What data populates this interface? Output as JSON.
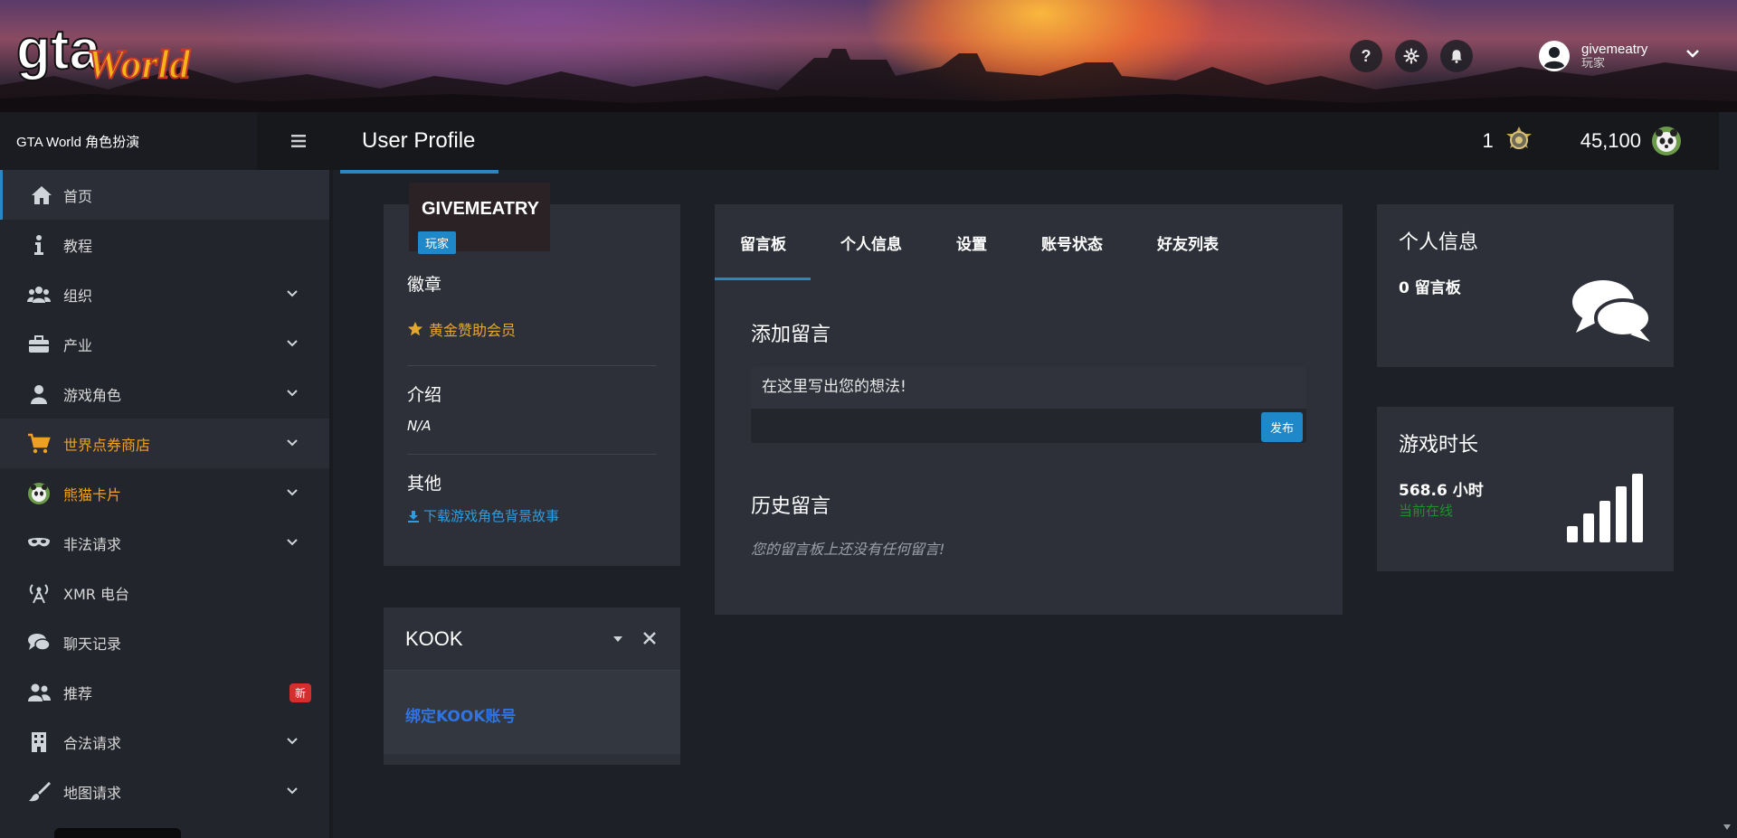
{
  "banner": {
    "logo_text_gta": "gta",
    "logo_text_world": "World",
    "icons": [
      "question-icon",
      "gear-icon",
      "bell-icon"
    ],
    "help_glyph": "?",
    "user": {
      "name": "givemeatry",
      "role": "玩家"
    }
  },
  "sidebar_head": {
    "title": "GTA World 角色扮演"
  },
  "topbar": {
    "page_title": "User Profile",
    "stats": [
      {
        "value": "1",
        "icon": "medal-icon"
      },
      {
        "value": "45,100",
        "icon": "panda-coin-icon"
      }
    ]
  },
  "sidebar": {
    "items": [
      {
        "label": "首页",
        "icon": "home-icon",
        "active": true
      },
      {
        "label": "教程",
        "icon": "info-icon"
      },
      {
        "label": "组织",
        "icon": "users-icon",
        "expand": true
      },
      {
        "label": "产业",
        "icon": "briefcase-icon",
        "expand": true
      },
      {
        "label": "游戏角色",
        "icon": "user-icon",
        "expand": true
      },
      {
        "label": "世界点券商店",
        "icon": "cart-icon",
        "expand": true,
        "color": "#f0a020"
      },
      {
        "label": "熊猫卡片",
        "icon": "panda-icon",
        "expand": true,
        "color": "#f0a020"
      },
      {
        "label": "非法请求",
        "icon": "mask-icon",
        "expand": true
      },
      {
        "label": "XMR 电台",
        "icon": "radio-icon"
      },
      {
        "label": "聊天记录",
        "icon": "chat-icon"
      },
      {
        "label": "推荐",
        "icon": "user-group-icon",
        "badge": "新"
      },
      {
        "label": "合法请求",
        "icon": "building-icon",
        "expand": true
      },
      {
        "label": "地图请求",
        "icon": "brush-icon",
        "expand": true
      }
    ]
  },
  "profile": {
    "name": "GIVEMEATRY",
    "role": "玩家",
    "badges_label": "徽章",
    "badge_item": "黄金赞助会员",
    "intro_label": "介绍",
    "intro_value": "N/A",
    "other_label": "其他",
    "download_link": "下载游戏角色背景故事"
  },
  "kook": {
    "title": "KOOK",
    "link": "绑定KOOK账号"
  },
  "wall": {
    "tabs": [
      "留言板",
      "个人信息",
      "设置",
      "账号状态",
      "好友列表"
    ],
    "add_heading": "添加留言",
    "composer_placeholder": "在这里写出您的想法!",
    "post_button": "发布",
    "history_heading": "历史留言",
    "empty_message": "您的留言板上还没有任何留言!"
  },
  "info_card": {
    "title": "个人信息",
    "value": "0 留言板",
    "icon": "comments-icon"
  },
  "time_card": {
    "title": "游戏时长",
    "value": "568.6 小时",
    "status": "当前在线",
    "icon": "signal-bars-icon"
  },
  "colors": {
    "accent": "#2e86c1",
    "gold": "#f0a020",
    "link_blue": "#2f9be0",
    "online_green": "#1e8f2e",
    "badge_red": "#d32f2f"
  }
}
